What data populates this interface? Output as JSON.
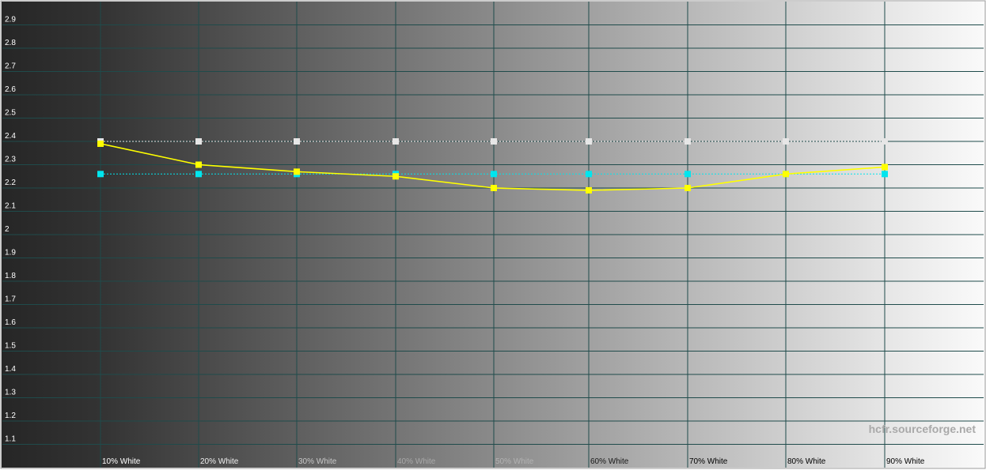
{
  "chart_data": {
    "type": "line",
    "title": "",
    "xlabel": "",
    "ylabel": "",
    "ylim": [
      1.0,
      3.0
    ],
    "y_ticks": [
      "1.1",
      "1.2",
      "1.3",
      "1.4",
      "1.5",
      "1.6",
      "1.7",
      "1.8",
      "1.9",
      "2",
      "2.1",
      "2.2",
      "2.3",
      "2.4",
      "2.5",
      "2.6",
      "2.7",
      "2.8",
      "2.9"
    ],
    "categories": [
      "10% White",
      "20% White",
      "30% White",
      "40% White",
      "50% White",
      "60% White",
      "70% White",
      "80% White",
      "90% White"
    ],
    "grid": true,
    "background": "grayscale gradient dark-to-light",
    "series": [
      {
        "values": [
          2.4,
          2.4,
          2.4,
          2.4,
          2.4,
          2.4,
          2.4,
          2.4,
          2.4
        ],
        "color": "#e6e6e6",
        "style": "dotted"
      },
      {
        "values": [
          2.26,
          2.26,
          2.26,
          2.26,
          2.26,
          2.26,
          2.26,
          2.26,
          2.26
        ],
        "color": "#00e5ee",
        "style": "dotted"
      },
      {
        "values": [
          2.39,
          2.3,
          2.27,
          2.25,
          2.2,
          2.19,
          2.2,
          2.26,
          2.29
        ],
        "color": "#ffff00",
        "style": "solid"
      }
    ]
  },
  "watermark": "hcfr.sourceforge.net"
}
